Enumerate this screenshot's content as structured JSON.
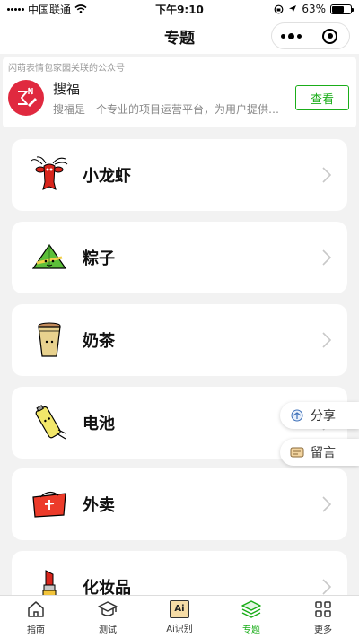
{
  "status_bar": {
    "carrier": "中国联通",
    "time": "下午9:10",
    "battery": "63%",
    "battery_level": 0.63
  },
  "nav": {
    "title": "专题"
  },
  "official_account": {
    "header": "闪萌表情包家园关联的公众号",
    "name": "搜福",
    "description": "搜福是一个专业的项目运营平台，为用户提供各...",
    "button": "查看",
    "accent": "#1aad19",
    "logo_color": "#e0293f"
  },
  "topics": [
    {
      "title": "小龙虾",
      "icon": "crayfish-icon"
    },
    {
      "title": "粽子",
      "icon": "zongzi-icon"
    },
    {
      "title": "奶茶",
      "icon": "milk-tea-icon"
    },
    {
      "title": "电池",
      "icon": "battery-icon"
    },
    {
      "title": "外卖",
      "icon": "takeout-bag-icon"
    },
    {
      "title": "化妆品",
      "icon": "lipstick-icon"
    }
  ],
  "float_actions": {
    "share": "分享",
    "message": "留言"
  },
  "tab_bar": {
    "active_color": "#1aad19",
    "items": [
      {
        "label": "指南",
        "icon": "home-icon"
      },
      {
        "label": "测试",
        "icon": "graduation-cap-icon"
      },
      {
        "label": "Ai识别",
        "icon_text": "Ai"
      },
      {
        "label": "专题",
        "icon": "layers-icon",
        "active": true
      },
      {
        "label": "更多",
        "icon": "grid-icon"
      }
    ]
  }
}
